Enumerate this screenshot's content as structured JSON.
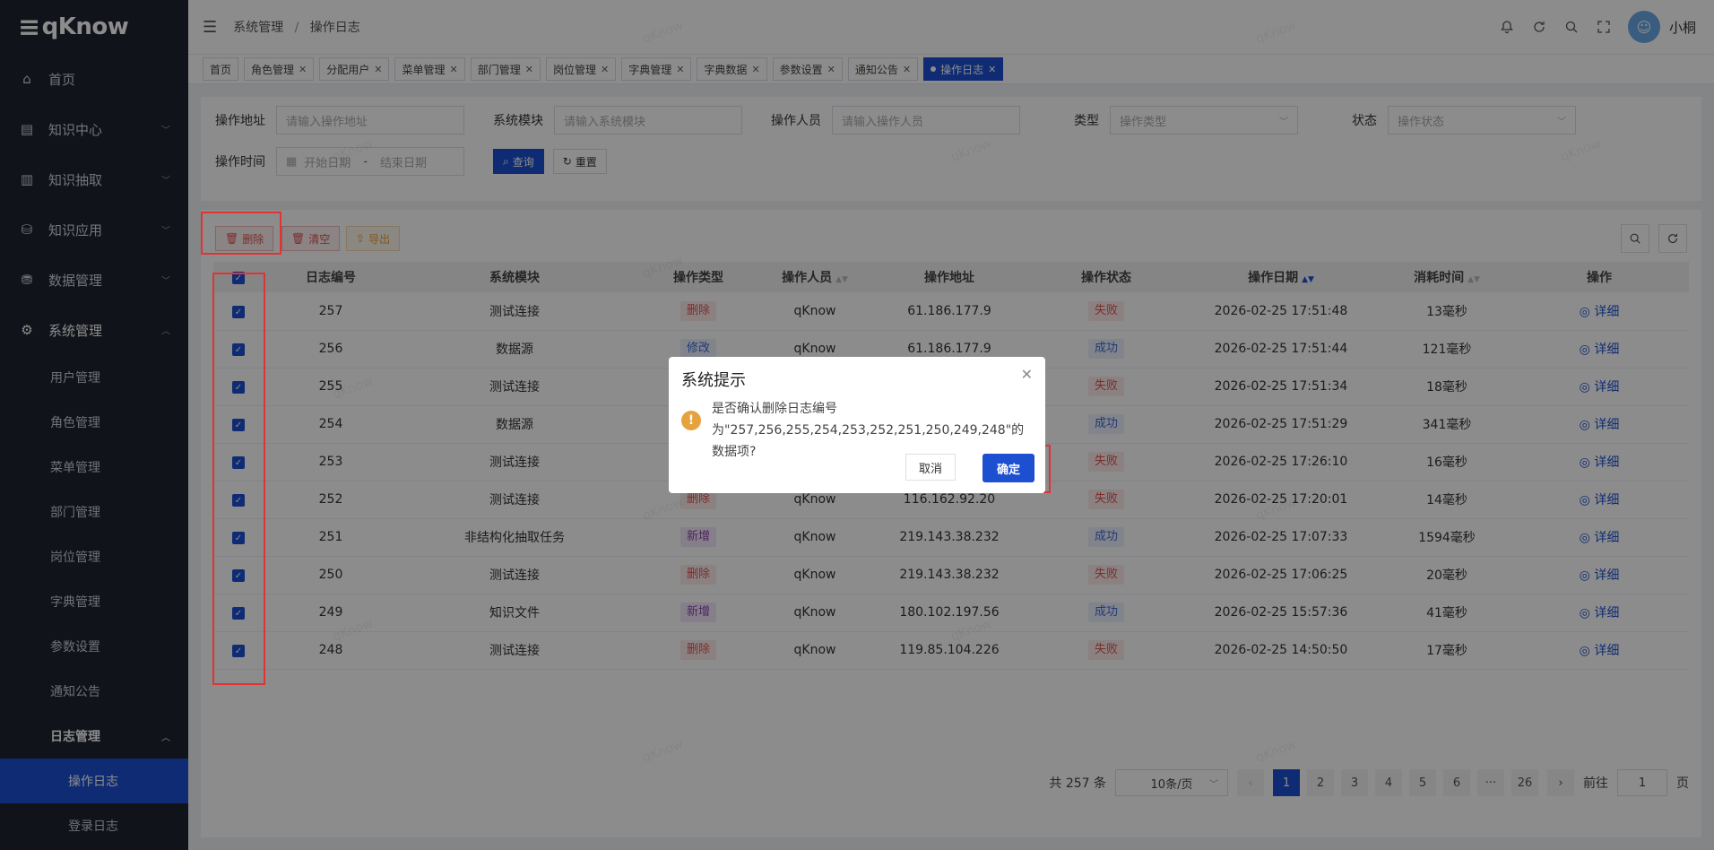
{
  "app": {
    "logo": "qKnow"
  },
  "sidebar": {
    "items": [
      {
        "label": "首页",
        "icon": "home-icon"
      },
      {
        "label": "知识中心",
        "icon": "book-icon"
      },
      {
        "label": "知识抽取",
        "icon": "doc-icon"
      },
      {
        "label": "知识应用",
        "icon": "app-icon"
      },
      {
        "label": "数据管理",
        "icon": "database-icon"
      },
      {
        "label": "系统管理",
        "icon": "gear-icon"
      }
    ],
    "sub_items": [
      "用户管理",
      "角色管理",
      "菜单管理",
      "部门管理",
      "岗位管理",
      "字典管理",
      "参数设置",
      "通知公告"
    ],
    "log_group": "日志管理",
    "log_items": [
      "操作日志",
      "登录日志"
    ]
  },
  "header": {
    "breadcrumb": [
      "系统管理",
      "操作日志"
    ],
    "username": "小桐"
  },
  "tabs": [
    "首页",
    "角色管理",
    "分配用户",
    "菜单管理",
    "部门管理",
    "岗位管理",
    "字典管理",
    "字典数据",
    "参数设置",
    "通知公告",
    "操作日志"
  ],
  "search": {
    "addr_label": "操作地址",
    "addr_placeholder": "请输入操作地址",
    "module_label": "系统模块",
    "module_placeholder": "请输入系统模块",
    "user_label": "操作人员",
    "user_placeholder": "请输入操作人员",
    "type_label": "类型",
    "type_placeholder": "操作类型",
    "status_label": "状态",
    "status_placeholder": "操作状态",
    "time_label": "操作时间",
    "start_placeholder": "开始日期",
    "range_sep": "-",
    "end_placeholder": "结束日期",
    "query_button": "查询",
    "reset_button": "重置"
  },
  "toolbar": {
    "delete": "删除",
    "clear": "清空",
    "export": "导出"
  },
  "table": {
    "columns": [
      "日志编号",
      "系统模块",
      "操作类型",
      "操作人员",
      "操作地址",
      "操作状态",
      "操作日期",
      "消耗时间",
      "操作"
    ],
    "detail_label": "详细",
    "rows": [
      {
        "id": "257",
        "module": "测试连接",
        "type": "删除",
        "user": "qKnow",
        "addr": "61.186.177.9",
        "status": "失败",
        "date": "2026-02-25 17:51:48",
        "cost": "13毫秒"
      },
      {
        "id": "256",
        "module": "数据源",
        "type": "修改",
        "user": "qKnow",
        "addr": "61.186.177.9",
        "status": "成功",
        "date": "2026-02-25 17:51:44",
        "cost": "121毫秒"
      },
      {
        "id": "255",
        "module": "测试连接",
        "type": "",
        "user": "",
        "addr": "",
        "status": "失败",
        "date": "2026-02-25 17:51:34",
        "cost": "18毫秒"
      },
      {
        "id": "254",
        "module": "数据源",
        "type": "",
        "user": "",
        "addr": "",
        "status": "成功",
        "date": "2026-02-25 17:51:29",
        "cost": "341毫秒"
      },
      {
        "id": "253",
        "module": "测试连接",
        "type": "",
        "user": "",
        "addr": "",
        "status": "失败",
        "date": "2026-02-25 17:26:10",
        "cost": "16毫秒"
      },
      {
        "id": "252",
        "module": "测试连接",
        "type": "删除",
        "user": "qKnow",
        "addr": "116.162.92.20",
        "status": "失败",
        "date": "2026-02-25 17:20:01",
        "cost": "14毫秒"
      },
      {
        "id": "251",
        "module": "非结构化抽取任务",
        "type": "新增",
        "user": "qKnow",
        "addr": "219.143.38.232",
        "status": "成功",
        "date": "2026-02-25 17:07:33",
        "cost": "1594毫秒"
      },
      {
        "id": "250",
        "module": "测试连接",
        "type": "删除",
        "user": "qKnow",
        "addr": "219.143.38.232",
        "status": "失败",
        "date": "2026-02-25 17:06:25",
        "cost": "20毫秒"
      },
      {
        "id": "249",
        "module": "知识文件",
        "type": "新增",
        "user": "qKnow",
        "addr": "180.102.197.56",
        "status": "成功",
        "date": "2026-02-25 15:57:36",
        "cost": "41毫秒"
      },
      {
        "id": "248",
        "module": "测试连接",
        "type": "删除",
        "user": "qKnow",
        "addr": "119.85.104.226",
        "status": "失败",
        "date": "2026-02-25 14:50:50",
        "cost": "17毫秒"
      }
    ]
  },
  "pagination": {
    "total": "共 257 条",
    "page_size": "10条/页",
    "pages": [
      "1",
      "2",
      "3",
      "4",
      "5",
      "6",
      "···",
      "26"
    ],
    "goto_label": "前往",
    "goto_value": "1",
    "page_unit": "页"
  },
  "dialog": {
    "title": "系统提示",
    "message_line1": "是否确认删除日志编号",
    "message_line2": "为\"257,256,255,254,253,252,251,250,249,248\"的数据项?",
    "cancel": "取消",
    "confirm": "确定"
  },
  "colors": {
    "primary": "#1d4fd1",
    "sidebar_bg": "#1f2430",
    "danger": "#e05252",
    "warning": "#e6a23c",
    "highlight": "#e03434"
  },
  "watermark": "qKnow"
}
